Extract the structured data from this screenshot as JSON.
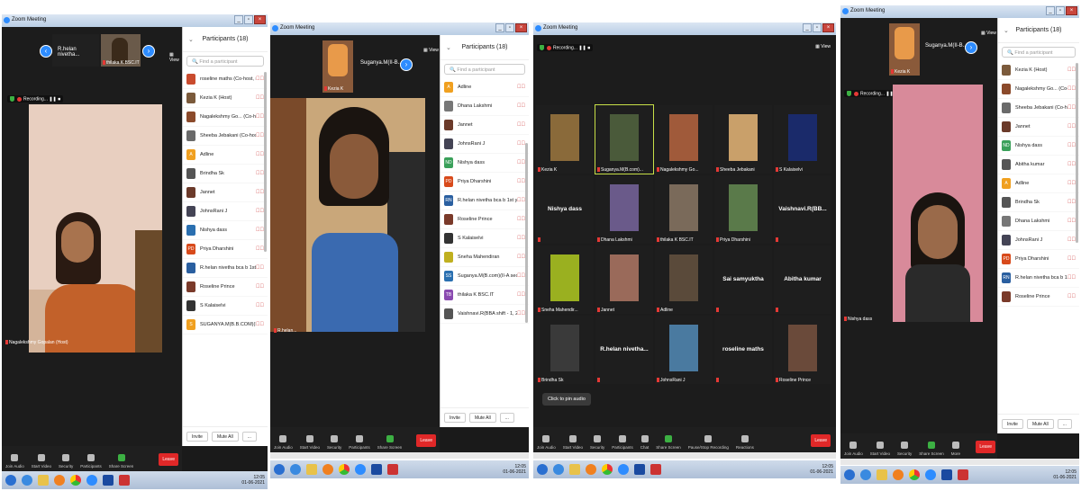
{
  "window_title": "Zoom Meeting",
  "view_label": "View",
  "recording_label": "Recording...",
  "participants_title": "Participants (18)",
  "search_placeholder": "Find a participant",
  "invite_label": "Invite",
  "mute_all_label": "Mute All",
  "more_dots": "...",
  "leave_label": "Leave",
  "toolbar": {
    "join_audio": "Join Audio",
    "start_video": "Start Video",
    "security": "Security",
    "participants": "Participants",
    "chat": "Chat",
    "share_screen": "Share Screen",
    "pause_stop_recording": "Pause/Stop Recording",
    "reactions": "Reactions",
    "more": "More",
    "participants_count": "18"
  },
  "panel1": {
    "thumb_name": "R.helan nivetha...",
    "thumb2_name": "thilaka K BSC.IT",
    "speaker_name": "Nagalekshmy Gopalan (Host)",
    "participants": [
      {
        "initial": "",
        "name": "roseline maths (Co-host, me)",
        "color": "#c94b2e"
      },
      {
        "initial": "",
        "name": "Kezia K (Host)",
        "color": "#7b5a3b"
      },
      {
        "initial": "",
        "name": "Nagalekshmy Go... (Co-host)",
        "color": "#8b4a2b"
      },
      {
        "initial": "",
        "name": "Sheeba Jebakani (Co-host)",
        "color": "#6a6a6a"
      },
      {
        "initial": "A",
        "name": "Adline",
        "color": "#f0a020"
      },
      {
        "initial": "",
        "name": "Brindha Sk",
        "color": "#555"
      },
      {
        "initial": "",
        "name": "Jannet",
        "color": "#6b3a2a"
      },
      {
        "initial": "",
        "name": "JohnsRani J",
        "color": "#445"
      },
      {
        "initial": "",
        "name": "Nishya dass",
        "color": "#2a6fb0"
      },
      {
        "initial": "PD",
        "name": "Priya Dharshini",
        "color": "#d84a1b"
      },
      {
        "initial": "",
        "name": "R.helan nivetha bca b 1st yr",
        "color": "#2a5fa0"
      },
      {
        "initial": "",
        "name": "Roseline Prince",
        "color": "#7a3a2a"
      },
      {
        "initial": "",
        "name": "S Kalaiselvi",
        "color": "#333"
      },
      {
        "initial": "S",
        "name": "SUGANYA.M(B.B.COM)(II-A sec)",
        "color": "#f0a020"
      }
    ]
  },
  "panel2": {
    "thumb_name": "Kezia K",
    "top_name": "Suganya.M(II-B...",
    "speaker_name": "R.helan...",
    "participants": [
      {
        "initial": "A",
        "name": "Adline",
        "color": "#f0a020"
      },
      {
        "initial": "",
        "name": "Dhana Lakshmi",
        "color": "#777"
      },
      {
        "initial": "",
        "name": "Jannet",
        "color": "#6b3a2a"
      },
      {
        "initial": "",
        "name": "JohnsRani J",
        "color": "#445"
      },
      {
        "initial": "ND",
        "name": "Nishya dass",
        "color": "#3aa05a"
      },
      {
        "initial": "PD",
        "name": "Priya Dharshini",
        "color": "#d84a1b"
      },
      {
        "initial": "RN",
        "name": "R.helan nivetha bca b 1st yr",
        "color": "#2a5fa0"
      },
      {
        "initial": "",
        "name": "Roseline Prince",
        "color": "#7a3a2a"
      },
      {
        "initial": "",
        "name": "S Kalaiselvi",
        "color": "#333"
      },
      {
        "initial": "",
        "name": "Sneha Mahendiran",
        "color": "#c0b020"
      },
      {
        "initial": "SS",
        "name": "Suganya.M(B.com)(II-A sec)",
        "color": "#2a6fb0"
      },
      {
        "initial": "TB",
        "name": "thilaka K BSC.IT",
        "color": "#8a4ab0"
      },
      {
        "initial": "",
        "name": "Vaishnavi.R(BBA shift - 1, 2nd ye...",
        "color": "#555"
      }
    ]
  },
  "panel3": {
    "pin_tooltip": "Click to pin audio",
    "tiles": [
      {
        "name": "Kezia K",
        "kind": "photo",
        "bg": "#8a6a3a"
      },
      {
        "name": "Suganya.M(B.com)...",
        "kind": "photo",
        "bg": "#4a5a3a"
      },
      {
        "name": "Nagalekshmy Go...",
        "kind": "photo",
        "bg": "#a05a3a"
      },
      {
        "name": "Sheeba Jebakani",
        "kind": "photo",
        "bg": "#c9a06a"
      },
      {
        "name": "S Kalaiselvi",
        "kind": "photo",
        "bg": "#1a2a6a"
      },
      {
        "name": "Nishya dass",
        "kind": "text",
        "bg": "#1e1e1e"
      },
      {
        "name": "Dhana Lakshmi",
        "kind": "photo",
        "bg": "#6a5a8a"
      },
      {
        "name": "thilaka K BSC.IT",
        "kind": "photo",
        "bg": "#7a6a5a"
      },
      {
        "name": "Priya Dharshini",
        "kind": "photo",
        "bg": "#5a7a4a"
      },
      {
        "name": "Vaishnavi.R(BB...",
        "kind": "text",
        "bg": "#1e1e1e"
      },
      {
        "name": "Sneha Mahendir...",
        "kind": "photo",
        "bg": "#9ab020"
      },
      {
        "name": "Jannet",
        "kind": "photo",
        "bg": "#9a6a5a"
      },
      {
        "name": "Adline",
        "kind": "photo",
        "bg": "#5a4a3a"
      },
      {
        "name": "Sai samyuktha",
        "kind": "text",
        "bg": "#1e1e1e"
      },
      {
        "name": "Abitha kumar",
        "kind": "text",
        "bg": "#1e1e1e"
      },
      {
        "name": "Brindha Sk",
        "kind": "photo",
        "bg": "#3a3a3a"
      },
      {
        "name": "R.helan nivetha...",
        "kind": "text",
        "bg": "#1e1e1e"
      },
      {
        "name": "JohnsRani J",
        "kind": "photo",
        "bg": "#4a7aa0"
      },
      {
        "name": "roseline maths",
        "kind": "text",
        "bg": "#1e1e1e"
      },
      {
        "name": "Roseline Prince",
        "kind": "photo",
        "bg": "#6a4a3a"
      }
    ]
  },
  "panel4": {
    "thumb_name": "Kezia K",
    "top_name": "Suganya.M(II-B...",
    "speaker_name": "Nishya dass",
    "participants": [
      {
        "initial": "",
        "name": "Kezia K (Host)",
        "color": "#7b5a3b"
      },
      {
        "initial": "",
        "name": "Nagalekshmy Go... (Co-host)",
        "color": "#8b4a2b"
      },
      {
        "initial": "",
        "name": "Sheeba Jebakani (Co-host)",
        "color": "#6a6a6a"
      },
      {
        "initial": "",
        "name": "Jannet",
        "color": "#6b3a2a"
      },
      {
        "initial": "ND",
        "name": "Nishya dass",
        "color": "#3aa05a"
      },
      {
        "initial": "",
        "name": "Abitha kumar",
        "color": "#555"
      },
      {
        "initial": "A",
        "name": "Adline",
        "color": "#f0a020"
      },
      {
        "initial": "",
        "name": "Brindha Sk",
        "color": "#555"
      },
      {
        "initial": "",
        "name": "Dhana Lakshmi",
        "color": "#777"
      },
      {
        "initial": "",
        "name": "JohnsRani J",
        "color": "#445"
      },
      {
        "initial": "PD",
        "name": "Priya Dharshini",
        "color": "#d84a1b"
      },
      {
        "initial": "RN",
        "name": "R.helan nivetha bca b 1st yr",
        "color": "#2a5fa0"
      },
      {
        "initial": "",
        "name": "Roseline Prince",
        "color": "#7a3a2a"
      }
    ]
  },
  "clock": {
    "time": "12:05",
    "date": "01-06-2021"
  },
  "colors": {
    "zoom_blue": "#2d8cff",
    "leave_red": "#e02828",
    "share_green": "#3cb043",
    "mic_muted": "#e53935"
  }
}
